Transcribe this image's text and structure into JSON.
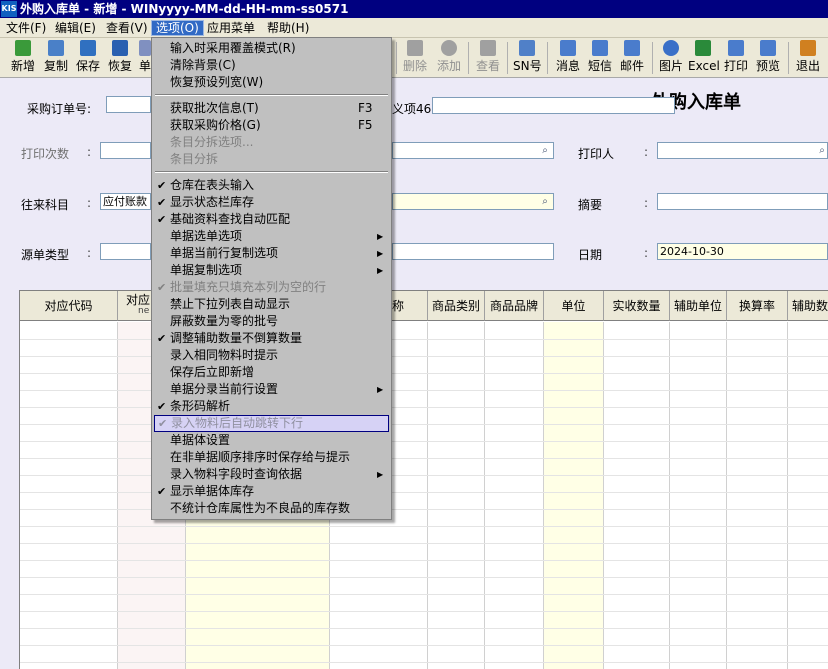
{
  "window": {
    "title": "外购入库单 - 新增 - WINyyyy-MM-dd-HH-mm-ss0571",
    "app_icon": "KIS"
  },
  "menubar": [
    {
      "label": "文件(F)"
    },
    {
      "label": "编辑(E)"
    },
    {
      "label": "查看(V)"
    },
    {
      "label": "选项(O)"
    },
    {
      "label": "应用菜单"
    },
    {
      "label": "帮助(H)"
    }
  ],
  "toolbar": {
    "add": "新增",
    "copy": "复制",
    "save": "保存",
    "restore": "恢复",
    "unit": "单",
    "delete": "删除",
    "append": "添加",
    "view": "查看",
    "sn": "SN号",
    "message": "消息",
    "sms": "短信",
    "email": "邮件",
    "image": "图片",
    "excel": "Excel",
    "print": "打印",
    "preview": "预览",
    "exit": "退出"
  },
  "form": {
    "title": "外购入库单",
    "po_number_label": "采购订单号:",
    "custom46_label": "义项46",
    "print_count_label": "打印次数",
    "printer_label": "打印人",
    "account_label": "往来科目",
    "account_value": "应付账款",
    "summary_label": "摘要",
    "source_type_label": "源单类型",
    "date_label": "日期",
    "date_value": "2024-10-30",
    "colon": ":"
  },
  "grid": {
    "headers": [
      "对应代码",
      "对应",
      "称",
      "商品类别",
      "商品品牌",
      "单位",
      "实收数量",
      "辅助单位",
      "换算率",
      "辅助数"
    ],
    "header_sub": "ne"
  },
  "dropdown_menu": {
    "items": [
      {
        "label": "输入时采用覆盖模式(R)",
        "checked": false
      },
      {
        "label": "清除背景(C)",
        "checked": false
      },
      {
        "label": "恢复预设列宽(W)",
        "checked": false
      },
      {
        "label": "获取批次信息(T)",
        "shortcut": "F3",
        "checked": false
      },
      {
        "label": "获取采购价格(G)",
        "shortcut": "F5",
        "checked": false
      },
      {
        "label": "条目分拆选项...",
        "checked": false,
        "disabled": true
      },
      {
        "label": "条目分拆",
        "checked": false,
        "disabled": true
      },
      {
        "label": "仓库在表头输入",
        "checked": true
      },
      {
        "label": "显示状态栏库存",
        "checked": true
      },
      {
        "label": "基础资料查找自动匹配",
        "checked": true
      },
      {
        "label": "单据选单选项",
        "submenu": true
      },
      {
        "label": "单据当前行复制选项",
        "submenu": true
      },
      {
        "label": "单据复制选项",
        "submenu": true
      },
      {
        "label": "批量填充只填充本列为空的行",
        "checked": true,
        "disabled": true
      },
      {
        "label": "禁止下拉列表自动显示",
        "checked": false
      },
      {
        "label": "屏蔽数量为零的批号",
        "checked": false
      },
      {
        "label": "调整辅助数量不倒算数量",
        "checked": true
      },
      {
        "label": "录入相同物料时提示",
        "checked": false
      },
      {
        "label": "保存后立即新增",
        "checked": false
      },
      {
        "label": "单据分录当前行设置",
        "submenu": true
      },
      {
        "label": "条形码解析",
        "checked": true
      },
      {
        "label": "录入物料后自动跳转下行",
        "checked": true,
        "highlighted": true
      },
      {
        "label": "单据体设置",
        "checked": false
      },
      {
        "label": "在非单据顺序排序时保存给与提示",
        "checked": false
      },
      {
        "label": "录入物料字段时查询依据",
        "submenu": true
      },
      {
        "label": "显示单据体库存",
        "checked": true
      },
      {
        "label": "不统计仓库属性为不良品的库存数",
        "checked": false
      }
    ],
    "check_glyph": "✔",
    "arrow_glyph": "▶"
  },
  "colors": {
    "title_bar": "#000080",
    "menu_highlight": "#316AC5",
    "menu_bg": "#C0C0C0",
    "form_bg": "#ECEAF7",
    "yellow_field": "#FFFFE6"
  },
  "icons": {
    "lookup": "search-lookup-icon"
  }
}
